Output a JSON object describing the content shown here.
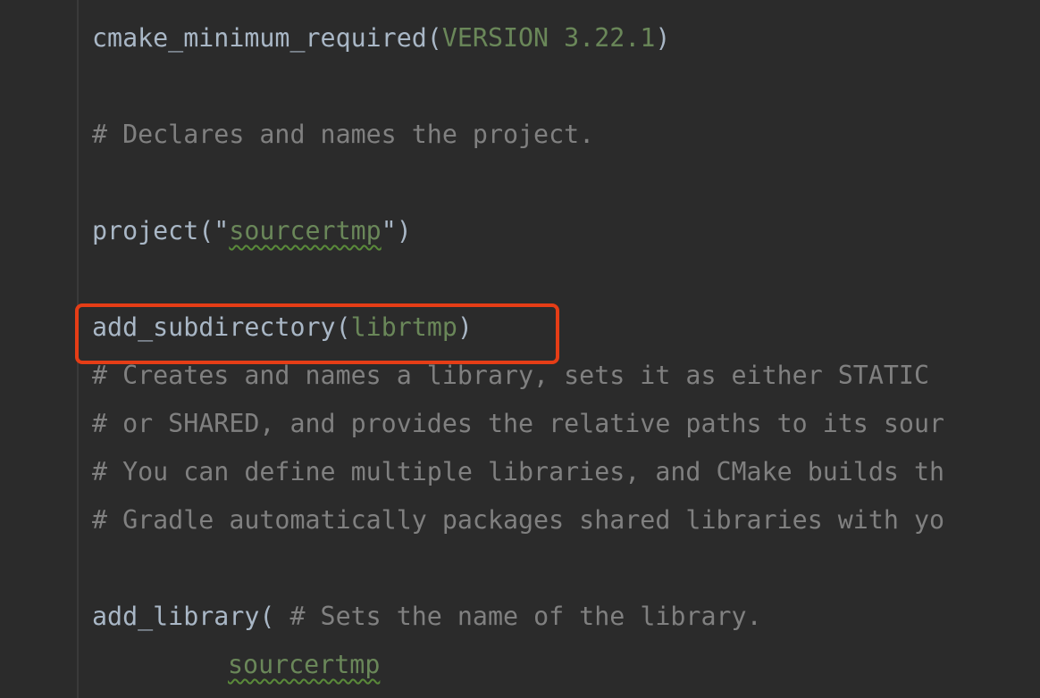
{
  "editor": {
    "lines": [
      {
        "parts": [
          {
            "t": "cmake_minimum_required",
            "c": "kw"
          },
          {
            "t": "(",
            "c": "par"
          },
          {
            "t": "VERSION 3.22.1",
            "c": "str-arg"
          },
          {
            "t": ")",
            "c": "par"
          }
        ]
      },
      {
        "parts": []
      },
      {
        "parts": [
          {
            "t": "# Declares and names the project.",
            "c": "cmt"
          }
        ]
      },
      {
        "parts": []
      },
      {
        "parts": [
          {
            "t": "project",
            "c": "kw"
          },
          {
            "t": "(\"",
            "c": "par"
          },
          {
            "t": "sourcertmp",
            "c": "str-arg squiggle"
          },
          {
            "t": "\")",
            "c": "par"
          }
        ]
      },
      {
        "parts": []
      },
      {
        "parts": [
          {
            "t": "add_subdirectory",
            "c": "kw"
          },
          {
            "t": "(",
            "c": "par"
          },
          {
            "t": "librtmp",
            "c": "str-arg"
          },
          {
            "t": ")",
            "c": "par"
          }
        ]
      },
      {
        "parts": [
          {
            "t": "# Creates and names a library, sets it as either STATIC",
            "c": "cmt"
          }
        ]
      },
      {
        "parts": [
          {
            "t": "# or SHARED, and provides the relative paths to its sour",
            "c": "cmt"
          }
        ]
      },
      {
        "parts": [
          {
            "t": "# You can define multiple libraries, and CMake builds th",
            "c": "cmt"
          }
        ]
      },
      {
        "parts": [
          {
            "t": "# Gradle automatically packages shared libraries with yo",
            "c": "cmt"
          }
        ]
      },
      {
        "parts": []
      },
      {
        "parts": [
          {
            "t": "add_library",
            "c": "kw"
          },
          {
            "t": "( ",
            "c": "par"
          },
          {
            "t": "# Sets the name of the library.",
            "c": "cmt"
          }
        ]
      },
      {
        "parts": [
          {
            "t": "sourcertmp",
            "c": "str-arg squiggle"
          }
        ],
        "indent": true
      }
    ]
  },
  "colors": {
    "background": "#2b2b2b",
    "text": "#a9b7c6",
    "argument": "#6a8759",
    "comment": "#808080",
    "highlight_border": "#e53d16"
  }
}
